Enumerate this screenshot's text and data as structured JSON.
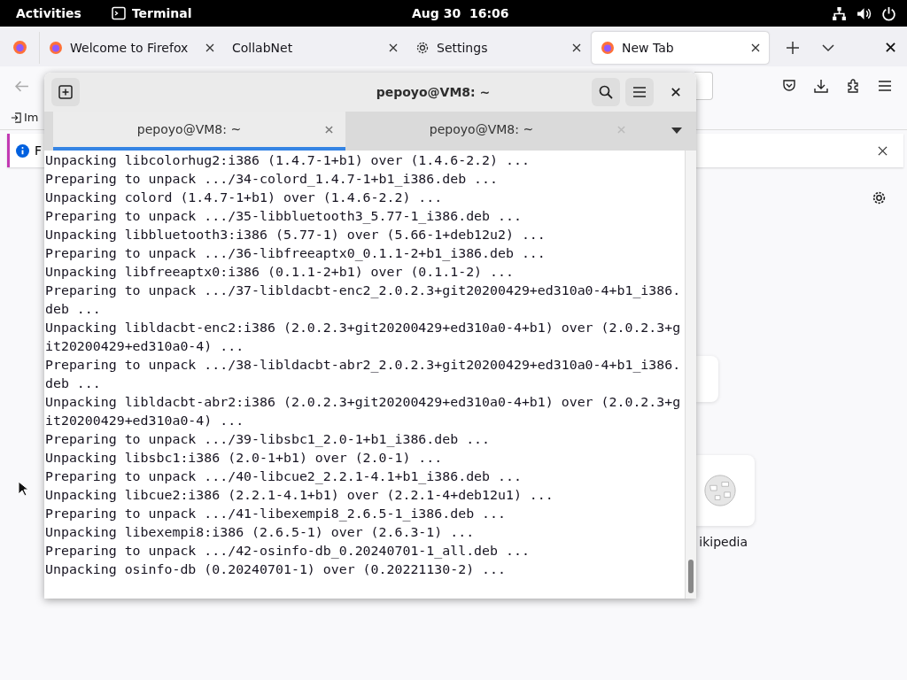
{
  "top_bar": {
    "activities": "Activities",
    "app": "Terminal",
    "clock": "Aug 30  16:06"
  },
  "browser": {
    "tabs": [
      {
        "title": "Welcome to Firefox",
        "kind": "firefox",
        "selected": false
      },
      {
        "title": "CollabNet",
        "kind": "plain",
        "selected": false
      },
      {
        "title": "Settings",
        "kind": "settings",
        "selected": false
      },
      {
        "title": "New Tab",
        "kind": "firefox",
        "selected": true
      }
    ],
    "bookmark": "Im",
    "notification": "F",
    "shortcuts": [
      {
        "kind": "blank"
      },
      {
        "kind": "wikipedia",
        "label": "ikipedia"
      }
    ]
  },
  "terminal": {
    "title": "pepoyo@VM8: ~",
    "tabs": [
      {
        "title": "pepoyo@VM8: ~",
        "selected": true
      },
      {
        "title": "pepoyo@VM8: ~",
        "selected": false
      }
    ],
    "lines": [
      "Unpacking libcolorhug2:i386 (1.4.7-1+b1) over (1.4.6-2.2) ...",
      "Preparing to unpack .../34-colord_1.4.7-1+b1_i386.deb ...",
      "Unpacking colord (1.4.7-1+b1) over (1.4.6-2.2) ...",
      "Preparing to unpack .../35-libbluetooth3_5.77-1_i386.deb ...",
      "Unpacking libbluetooth3:i386 (5.77-1) over (5.66-1+deb12u2) ...",
      "Preparing to unpack .../36-libfreeaptx0_0.1.1-2+b1_i386.deb ...",
      "Unpacking libfreeaptx0:i386 (0.1.1-2+b1) over (0.1.1-2) ...",
      "Preparing to unpack .../37-libldacbt-enc2_2.0.2.3+git20200429+ed310a0-4+b1_i386.",
      "deb ...",
      "Unpacking libldacbt-enc2:i386 (2.0.2.3+git20200429+ed310a0-4+b1) over (2.0.2.3+g",
      "it20200429+ed310a0-4) ...",
      "Preparing to unpack .../38-libldacbt-abr2_2.0.2.3+git20200429+ed310a0-4+b1_i386.",
      "deb ...",
      "Unpacking libldacbt-abr2:i386 (2.0.2.3+git20200429+ed310a0-4+b1) over (2.0.2.3+g",
      "it20200429+ed310a0-4) ...",
      "Preparing to unpack .../39-libsbc1_2.0-1+b1_i386.deb ...",
      "Unpacking libsbc1:i386 (2.0-1+b1) over (2.0-1) ...",
      "Preparing to unpack .../40-libcue2_2.2.1-4.1+b1_i386.deb ...",
      "Unpacking libcue2:i386 (2.2.1-4.1+b1) over (2.2.1-4+deb12u1) ...",
      "Preparing to unpack .../41-libexempi8_2.6.5-1_i386.deb ...",
      "Unpacking libexempi8:i386 (2.6.5-1) over (2.6.3-1) ...",
      "Preparing to unpack .../42-osinfo-db_0.20240701-1_all.deb ...",
      "Unpacking osinfo-db (0.20240701-1) over (0.20221130-2) ..."
    ]
  }
}
